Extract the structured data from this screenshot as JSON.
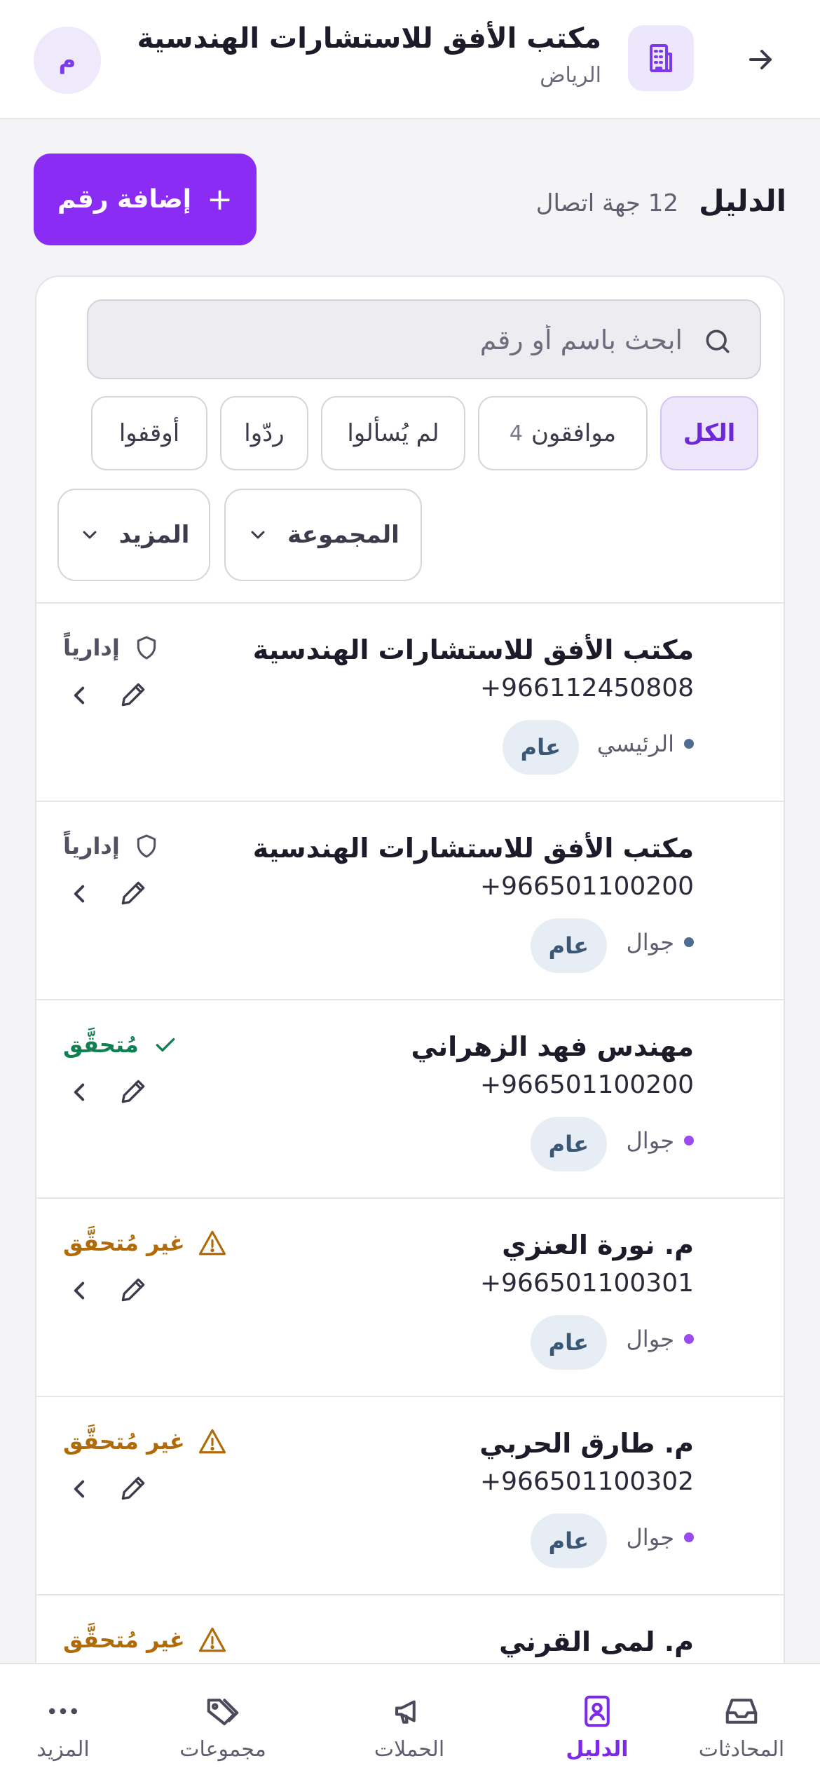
{
  "header": {
    "title": "مكتب الأفق للاستشارات الهندسية",
    "subtitle": "الرياض",
    "avatar_initial": "م"
  },
  "directory": {
    "title": "الدليل",
    "count_label": "12 جهة اتصال",
    "add_button_label": "إضافة رقم",
    "add_button_plus": "+"
  },
  "search": {
    "placeholder": "ابحث باسم أو رقم",
    "value": ""
  },
  "filters": [
    {
      "label": "الكل",
      "count": "",
      "active": true
    },
    {
      "label": "موافقون",
      "count": "4",
      "active": false
    },
    {
      "label": "لم يُسألوا",
      "count": "",
      "active": false
    },
    {
      "label": "ردّوا",
      "count": "",
      "active": false
    },
    {
      "label": "أوقفوا",
      "count": "",
      "active": false
    }
  ],
  "dropdowns": {
    "group_label": "المجموعة",
    "more_label": "المزيد"
  },
  "contacts": [
    {
      "name": "مكتب الأفق للاستشارات الهندسية",
      "phone": "+966112450808",
      "type": "الرئيسي",
      "dot_color": "#4f6d93",
      "tag": "عام",
      "status": "إدارياً",
      "status_kind": "admin"
    },
    {
      "name": "مكتب الأفق للاستشارات الهندسية",
      "phone": "+966501100200",
      "type": "جوال",
      "dot_color": "#4f6d93",
      "tag": "عام",
      "status": "إدارياً",
      "status_kind": "admin"
    },
    {
      "name": "مهندس فهد الزهراني",
      "phone": "+966501100200",
      "type": "جوال",
      "dot_color": "#9a4cf0",
      "tag": "عام",
      "status": "مُتحقَّق",
      "status_kind": "verified"
    },
    {
      "name": "م. نورة العنزي",
      "phone": "+966501100301",
      "type": "جوال",
      "dot_color": "#9a4cf0",
      "tag": "عام",
      "status": "غير مُتحقَّق",
      "status_kind": "unverified"
    },
    {
      "name": "م. طارق الحربي",
      "phone": "+966501100302",
      "type": "جوال",
      "dot_color": "#9a4cf0",
      "tag": "عام",
      "status": "غير مُتحقَّق",
      "status_kind": "unverified"
    },
    {
      "name": "م. لمى القرني",
      "phone": "",
      "type": "",
      "dot_color": "#9a4cf0",
      "tag": "",
      "status": "غير مُتحقَّق",
      "status_kind": "unverified"
    }
  ],
  "nav": [
    {
      "label": "المحادثات",
      "icon": "inbox-icon",
      "active": false
    },
    {
      "label": "الدليل",
      "icon": "contact-book-icon",
      "active": true
    },
    {
      "label": "الحملات",
      "icon": "megaphone-icon",
      "active": false
    },
    {
      "label": "مجموعات",
      "icon": "tags-icon",
      "active": false
    },
    {
      "label": "المزيد",
      "icon": "more-dots-icon",
      "active": false
    }
  ],
  "colors": {
    "accent": "#8b2cf5",
    "verified": "#0f8050",
    "unverified": "#b06b08",
    "tag_bg": "#e6edf5"
  }
}
